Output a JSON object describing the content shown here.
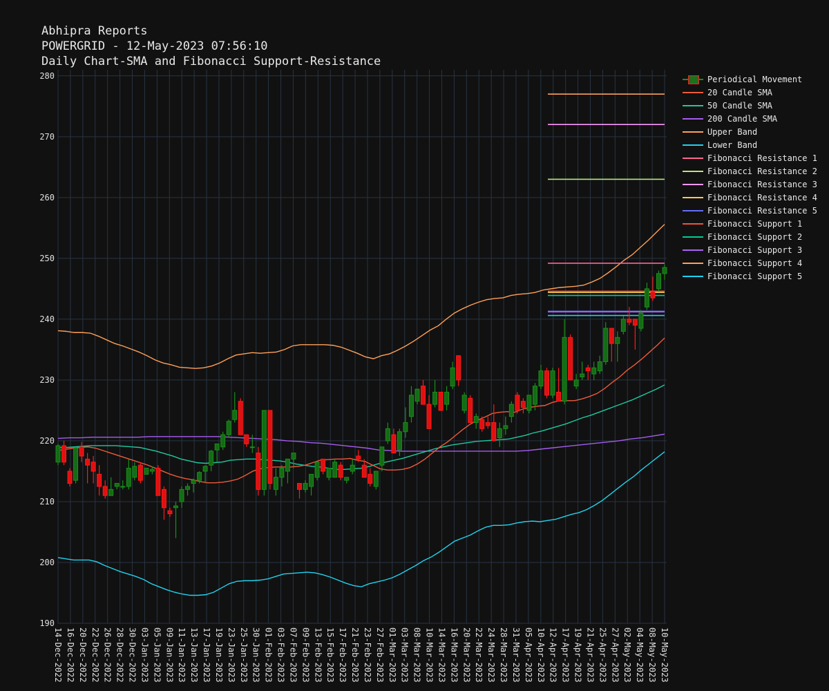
{
  "header": {
    "line1": "Abhipra Reports",
    "line2": "POWERGRID - 12-May-2023 07:56:10",
    "line3": "Daily Chart-SMA and Fibonacci Support-Resistance"
  },
  "legend": [
    {
      "label": "Periodical Movement",
      "color": "#1f9f1f",
      "type": "candle"
    },
    {
      "label": "20 Candle SMA",
      "color": "#ef5a3c",
      "type": "line"
    },
    {
      "label": "50 Candle SMA",
      "color": "#1fc9a0",
      "type": "line"
    },
    {
      "label": "200 Candle SMA",
      "color": "#a65cf0",
      "type": "line"
    },
    {
      "label": "Upper Band",
      "color": "#ffa15a",
      "type": "line"
    },
    {
      "label": "Lower Band",
      "color": "#22d3ee",
      "type": "line"
    },
    {
      "label": "Fibonacci Resistance 1",
      "color": "#ff6692",
      "type": "line"
    },
    {
      "label": "Fibonacci Resistance 2",
      "color": "#b6e880",
      "type": "line"
    },
    {
      "label": "Fibonacci Resistance 3",
      "color": "#ff97ff",
      "type": "line"
    },
    {
      "label": "Fibonacci Resistance 4",
      "color": "#fecb52",
      "type": "line"
    },
    {
      "label": "Fibonacci Resistance 5",
      "color": "#636efa",
      "type": "line"
    },
    {
      "label": "Fibonacci Support 1",
      "color": "#ef553b",
      "type": "line"
    },
    {
      "label": "Fibonacci Support 2",
      "color": "#00cc96",
      "type": "line"
    },
    {
      "label": "Fibonacci Support 3",
      "color": "#ab63fa",
      "type": "line"
    },
    {
      "label": "Fibonacci Support 4",
      "color": "#ffa15a",
      "type": "line"
    },
    {
      "label": "Fibonacci Support 5",
      "color": "#19d3f3",
      "type": "line"
    }
  ],
  "chart_data": {
    "type": "candlestick",
    "ylim": [
      190,
      281
    ],
    "yticks": [
      190,
      200,
      210,
      220,
      230,
      240,
      250,
      260,
      270,
      280
    ],
    "xtick_labels": [
      "14-Dec-2022",
      "16-Dec-2022",
      "20-Dec-2022",
      "22-Dec-2022",
      "26-Dec-2022",
      "28-Dec-2022",
      "30-Dec-2022",
      "03-Jan-2023",
      "05-Jan-2023",
      "09-Jan-2023",
      "11-Jan-2023",
      "13-Jan-2023",
      "17-Jan-2023",
      "19-Jan-2023",
      "23-Jan-2023",
      "25-Jan-2023",
      "30-Jan-2023",
      "01-Feb-2023",
      "03-Feb-2023",
      "07-Feb-2023",
      "09-Feb-2023",
      "13-Feb-2023",
      "15-Feb-2023",
      "17-Feb-2023",
      "21-Feb-2023",
      "23-Feb-2023",
      "27-Feb-2023",
      "01-Mar-2023",
      "03-Mar-2023",
      "08-Mar-2023",
      "10-Mar-2023",
      "14-Mar-2023",
      "16-Mar-2023",
      "20-Mar-2023",
      "22-Mar-2023",
      "24-Mar-2023",
      "28-Mar-2023",
      "31-Mar-2023",
      "05-Apr-2023",
      "10-Apr-2023",
      "12-Apr-2023",
      "17-Apr-2023",
      "19-Apr-2023",
      "21-Apr-2023",
      "25-Apr-2023",
      "27-Apr-2023",
      "02-May-2023",
      "04-May-2023",
      "08-May-2023",
      "10-May-2023"
    ],
    "grid": true,
    "candles": [
      [
        216.5,
        219.5,
        216.0,
        219.2
      ],
      [
        219.2,
        220.0,
        216.0,
        216.5
      ],
      [
        215.0,
        215.5,
        212.5,
        213.0
      ],
      [
        213.5,
        219.0,
        213.0,
        218.8
      ],
      [
        219.0,
        219.8,
        216.5,
        217.5
      ],
      [
        217.0,
        218.0,
        213.0,
        216.0
      ],
      [
        216.5,
        217.5,
        213.0,
        215.0
      ],
      [
        214.5,
        216.0,
        211.0,
        212.5
      ],
      [
        212.5,
        213.5,
        210.5,
        211.0
      ],
      [
        211.0,
        214.0,
        211.0,
        212.0
      ],
      [
        212.5,
        213.0,
        212.0,
        213.0
      ],
      [
        212.5,
        213.5,
        212.0,
        212.5
      ],
      [
        212.5,
        217.0,
        212.0,
        215.5
      ],
      [
        214.0,
        216.5,
        213.5,
        215.8
      ],
      [
        216.0,
        216.5,
        213.0,
        213.5
      ],
      [
        214.5,
        215.5,
        214.5,
        215.5
      ],
      [
        215.0,
        215.8,
        214.5,
        215.3
      ],
      [
        215.5,
        216.0,
        211.0,
        211.0
      ],
      [
        212.0,
        212.5,
        207.0,
        209.0
      ],
      [
        208.5,
        209.0,
        207.5,
        208.0
      ],
      [
        209.0,
        210.0,
        204.0,
        209.3
      ],
      [
        210.0,
        212.5,
        209.0,
        212.0
      ],
      [
        212.0,
        213.0,
        211.0,
        212.5
      ],
      [
        213.0,
        213.8,
        211.5,
        213.5
      ],
      [
        213.5,
        215.0,
        213.0,
        214.8
      ],
      [
        215.0,
        216.0,
        213.0,
        215.8
      ],
      [
        216.0,
        218.5,
        215.0,
        218.3
      ],
      [
        218.5,
        219.5,
        216.5,
        219.5
      ],
      [
        219.0,
        221.5,
        218.5,
        221.0
      ],
      [
        221.0,
        223.5,
        220.5,
        223.2
      ],
      [
        223.5,
        228.0,
        223.0,
        225.0
      ],
      [
        226.5,
        227.0,
        221.0,
        221.0
      ],
      [
        221.0,
        220.5,
        219.0,
        219.5
      ],
      [
        219.0,
        221.0,
        218.0,
        219.0
      ],
      [
        218.0,
        219.0,
        211.0,
        212.0
      ],
      [
        212.0,
        225.0,
        211.0,
        225.0
      ],
      [
        225.0,
        221.0,
        212.0,
        213.0
      ],
      [
        212.0,
        215.5,
        211.0,
        214.0
      ],
      [
        214.0,
        216.0,
        212.5,
        215.5
      ],
      [
        215.0,
        217.0,
        213.0,
        217.0
      ],
      [
        217.0,
        218.0,
        215.5,
        218.0
      ],
      [
        213.0,
        213.0,
        210.5,
        212.0
      ],
      [
        212.0,
        213.5,
        211.5,
        213.0
      ],
      [
        212.5,
        214.5,
        211.0,
        214.5
      ],
      [
        214.0,
        216.0,
        213.5,
        216.5
      ],
      [
        217.0,
        217.0,
        214.5,
        215.0
      ],
      [
        214.0,
        215.0,
        213.5,
        215.5
      ],
      [
        214.0,
        217.0,
        214.0,
        216.5
      ],
      [
        216.0,
        216.5,
        213.5,
        214.0
      ],
      [
        213.5,
        214.0,
        213.0,
        214.0
      ],
      [
        215.0,
        217.0,
        214.5,
        216.0
      ],
      [
        217.5,
        218.5,
        216.5,
        217.0
      ],
      [
        216.0,
        217.0,
        214.5,
        214.0
      ],
      [
        214.5,
        215.5,
        212.5,
        213.0
      ],
      [
        212.5,
        215.0,
        212.0,
        215.0
      ],
      [
        216.0,
        219.0,
        215.0,
        219.0
      ],
      [
        220.0,
        223.0,
        219.5,
        222.0
      ],
      [
        221.0,
        222.0,
        218.5,
        218.0
      ],
      [
        218.5,
        222.0,
        217.5,
        221.5
      ],
      [
        221.5,
        225.5,
        220.5,
        223.0
      ],
      [
        224.0,
        229.0,
        223.0,
        227.5
      ],
      [
        226.5,
        228.5,
        226.0,
        228.5
      ],
      [
        229.0,
        230.0,
        227.5,
        226.0
      ],
      [
        226.0,
        227.5,
        222.0,
        222.0
      ],
      [
        226.0,
        230.0,
        225.5,
        228.0
      ],
      [
        228.0,
        225.5,
        225.0,
        225.0
      ],
      [
        226.0,
        229.0,
        225.0,
        228.0
      ],
      [
        229.0,
        233.0,
        228.5,
        232.0
      ],
      [
        234.0,
        234.0,
        229.0,
        230.0
      ],
      [
        225.0,
        228.0,
        224.5,
        227.5
      ],
      [
        227.0,
        227.5,
        223.0,
        223.0
      ],
      [
        223.0,
        224.5,
        222.0,
        224.0
      ],
      [
        223.5,
        224.0,
        221.5,
        222.0
      ],
      [
        223.0,
        224.0,
        222.0,
        222.5
      ],
      [
        223.0,
        226.0,
        220.0,
        220.0
      ],
      [
        220.5,
        223.0,
        219.0,
        222.0
      ],
      [
        222.0,
        224.0,
        221.0,
        222.5
      ],
      [
        224.0,
        226.5,
        223.0,
        226.0
      ],
      [
        227.5,
        228.0,
        224.5,
        225.0
      ],
      [
        226.5,
        227.0,
        224.5,
        225.5
      ],
      [
        225.0,
        227.5,
        224.5,
        227.5
      ],
      [
        226.0,
        229.5,
        225.0,
        229.0
      ],
      [
        229.0,
        232.5,
        228.5,
        231.5
      ],
      [
        231.5,
        232.0,
        227.0,
        227.5
      ],
      [
        227.5,
        232.0,
        227.0,
        231.5
      ],
      [
        228.0,
        232.0,
        227.5,
        226.5
      ],
      [
        226.5,
        240.0,
        226.0,
        237.0
      ],
      [
        237.0,
        237.5,
        231.0,
        230.0
      ],
      [
        229.0,
        231.0,
        228.5,
        230.0
      ],
      [
        230.5,
        233.0,
        230.0,
        231.0
      ],
      [
        232.0,
        232.5,
        230.0,
        231.5
      ],
      [
        231.0,
        233.0,
        230.0,
        232.0
      ],
      [
        231.5,
        234.0,
        231.0,
        233.0
      ],
      [
        233.0,
        239.5,
        232.5,
        238.5
      ],
      [
        238.5,
        238.0,
        233.0,
        236.0
      ],
      [
        236.0,
        238.0,
        233.0,
        237.0
      ],
      [
        238.0,
        240.5,
        237.5,
        240.0
      ],
      [
        240.0,
        242.0,
        239.0,
        239.5
      ],
      [
        240.0,
        240.0,
        235.0,
        239.0
      ],
      [
        238.5,
        241.5,
        238.0,
        241.0
      ],
      [
        242.0,
        246.0,
        241.5,
        245.0
      ],
      [
        244.5,
        247.0,
        243.0,
        243.5
      ],
      [
        245.0,
        248.0,
        244.5,
        247.5
      ],
      [
        247.5,
        249.0,
        246.5,
        248.5
      ]
    ],
    "sma20": [
      218.4,
      218.6,
      218.8,
      218.9,
      219.0,
      218.8,
      218.4,
      218.0,
      217.6,
      217.2,
      216.8,
      216.4,
      216.0,
      215.5,
      215.0,
      214.5,
      214.1,
      213.8,
      213.6,
      213.3,
      213.1,
      213.1,
      213.2,
      213.4,
      213.7,
      214.3,
      215.0,
      215.4,
      215.6,
      215.7,
      215.7,
      215.7,
      215.8,
      216.0,
      216.4,
      216.8,
      216.9,
      217.0,
      217.0,
      217.1,
      216.8,
      216.6,
      216.0,
      215.4,
      215.2,
      215.2,
      215.3,
      215.6,
      216.2,
      217.0,
      218.0,
      219.0,
      219.8,
      220.8,
      221.8,
      222.7,
      223.4,
      223.9,
      224.5,
      224.7,
      224.8,
      224.7,
      225.2,
      225.5,
      225.7,
      225.8,
      226.3,
      226.6,
      226.6,
      226.6,
      226.9,
      227.3,
      227.8,
      228.6,
      229.6,
      230.5,
      231.6,
      232.5,
      233.5,
      234.6,
      235.7,
      236.9
    ],
    "sma50": [
      218.9,
      218.9,
      219.0,
      219.1,
      219.2,
      219.2,
      219.2,
      219.2,
      219.1,
      219.0,
      218.9,
      218.6,
      218.3,
      217.9,
      217.5,
      217.0,
      216.7,
      216.4,
      216.3,
      216.4,
      216.5,
      216.8,
      216.9,
      217.0,
      217.0,
      216.9,
      216.8,
      216.7,
      216.5,
      216.2,
      216.0,
      215.8,
      215.7,
      215.5,
      215.3,
      215.3,
      215.4,
      215.5,
      215.8,
      216.2,
      216.5,
      216.8,
      217.1,
      217.5,
      217.9,
      218.3,
      218.7,
      219.0,
      219.3,
      219.5,
      219.7,
      219.9,
      220.0,
      220.1,
      220.2,
      220.3,
      220.6,
      220.9,
      221.3,
      221.6,
      222.0,
      222.4,
      222.8,
      223.3,
      223.8,
      224.2,
      224.7,
      225.2,
      225.7,
      226.2,
      226.7,
      227.3,
      227.9,
      228.5,
      229.2
    ],
    "sma200": [
      220.4,
      220.5,
      220.5,
      220.6,
      220.6,
      220.6,
      220.6,
      220.6,
      220.7,
      220.7,
      220.7,
      220.7,
      220.7,
      220.7,
      220.7,
      220.6,
      220.5,
      220.4,
      220.3,
      220.2,
      220.0,
      219.9,
      219.7,
      219.6,
      219.4,
      219.2,
      219.0,
      218.8,
      218.5,
      218.4,
      218.3,
      218.3,
      218.3,
      218.3,
      218.3,
      218.3,
      218.3,
      218.3,
      218.3,
      218.3,
      218.3,
      218.4,
      218.6,
      218.8,
      219.0,
      219.2,
      219.4,
      219.6,
      219.8,
      220.0,
      220.3,
      220.5,
      220.8,
      221.1
    ],
    "upper_band": [
      238.1,
      238.0,
      237.8,
      237.8,
      237.7,
      237.2,
      236.6,
      236.0,
      235.6,
      235.1,
      234.6,
      234.0,
      233.3,
      232.8,
      232.5,
      232.1,
      232.0,
      231.9,
      232.0,
      232.3,
      232.8,
      233.5,
      234.1,
      234.3,
      234.5,
      234.4,
      234.5,
      234.6,
      235.0,
      235.6,
      235.8,
      235.8,
      235.8,
      235.8,
      235.7,
      235.4,
      234.9,
      234.4,
      233.8,
      233.5,
      234.0,
      234.3,
      234.9,
      235.6,
      236.4,
      237.3,
      238.2,
      238.9,
      240.0,
      241.0,
      241.7,
      242.3,
      242.8,
      243.2,
      243.4,
      243.5,
      243.9,
      244.1,
      244.2,
      244.4,
      244.8,
      245.0,
      245.2,
      245.3,
      245.4,
      245.6,
      246.1,
      246.7,
      247.6,
      248.6,
      249.7,
      250.6,
      251.8,
      253.0,
      254.3,
      255.6
    ],
    "lower_band": [
      200.8,
      200.6,
      200.4,
      200.4,
      200.4,
      200.1,
      199.5,
      199.0,
      198.5,
      198.1,
      197.7,
      197.2,
      196.5,
      196.0,
      195.5,
      195.1,
      194.8,
      194.6,
      194.6,
      194.7,
      195.1,
      195.8,
      196.5,
      196.9,
      197.0,
      197.0,
      197.1,
      197.3,
      197.7,
      198.1,
      198.2,
      198.3,
      198.4,
      198.3,
      198.0,
      197.6,
      197.1,
      196.6,
      196.2,
      196.0,
      196.5,
      196.8,
      197.1,
      197.5,
      198.1,
      198.8,
      199.5,
      200.3,
      200.9,
      201.7,
      202.6,
      203.5,
      204.0,
      204.5,
      205.2,
      205.8,
      206.1,
      206.1,
      206.2,
      206.5,
      206.7,
      206.8,
      206.7,
      206.9,
      207.1,
      207.5,
      207.9,
      208.2,
      208.7,
      209.4,
      210.2,
      211.2,
      212.2,
      213.2,
      214.1,
      215.2,
      216.2,
      217.2,
      218.2
    ]
  },
  "fibonacci": {
    "levels": [
      {
        "name": "Fibonacci Resistance 1",
        "value": 249.2,
        "color": "#ff6692"
      },
      {
        "name": "Fibonacci Resistance 2",
        "value": 263.0,
        "color": "#b6e880"
      },
      {
        "name": "Fibonacci Resistance 3",
        "value": 272.0,
        "color": "#ff97ff"
      },
      {
        "name": "Fibonacci Resistance 4",
        "value": 244.4,
        "color": "#fecb52"
      },
      {
        "name": "Fibonacci Resistance 5",
        "value": 241.3,
        "color": "#636efa"
      },
      {
        "name": "Fibonacci Support 1",
        "value": 244.6,
        "color": "#ef553b"
      },
      {
        "name": "Fibonacci Support 2",
        "value": 243.9,
        "color": "#00cc96"
      },
      {
        "name": "Fibonacci Support 3",
        "value": 241.2,
        "color": "#ab63fa"
      },
      {
        "name": "Fibonacci Support 4",
        "value": 277.0,
        "color": "#ffa15a"
      },
      {
        "name": "Fibonacci Support 5",
        "value": 240.6,
        "color": "#19d3f3"
      }
    ]
  }
}
